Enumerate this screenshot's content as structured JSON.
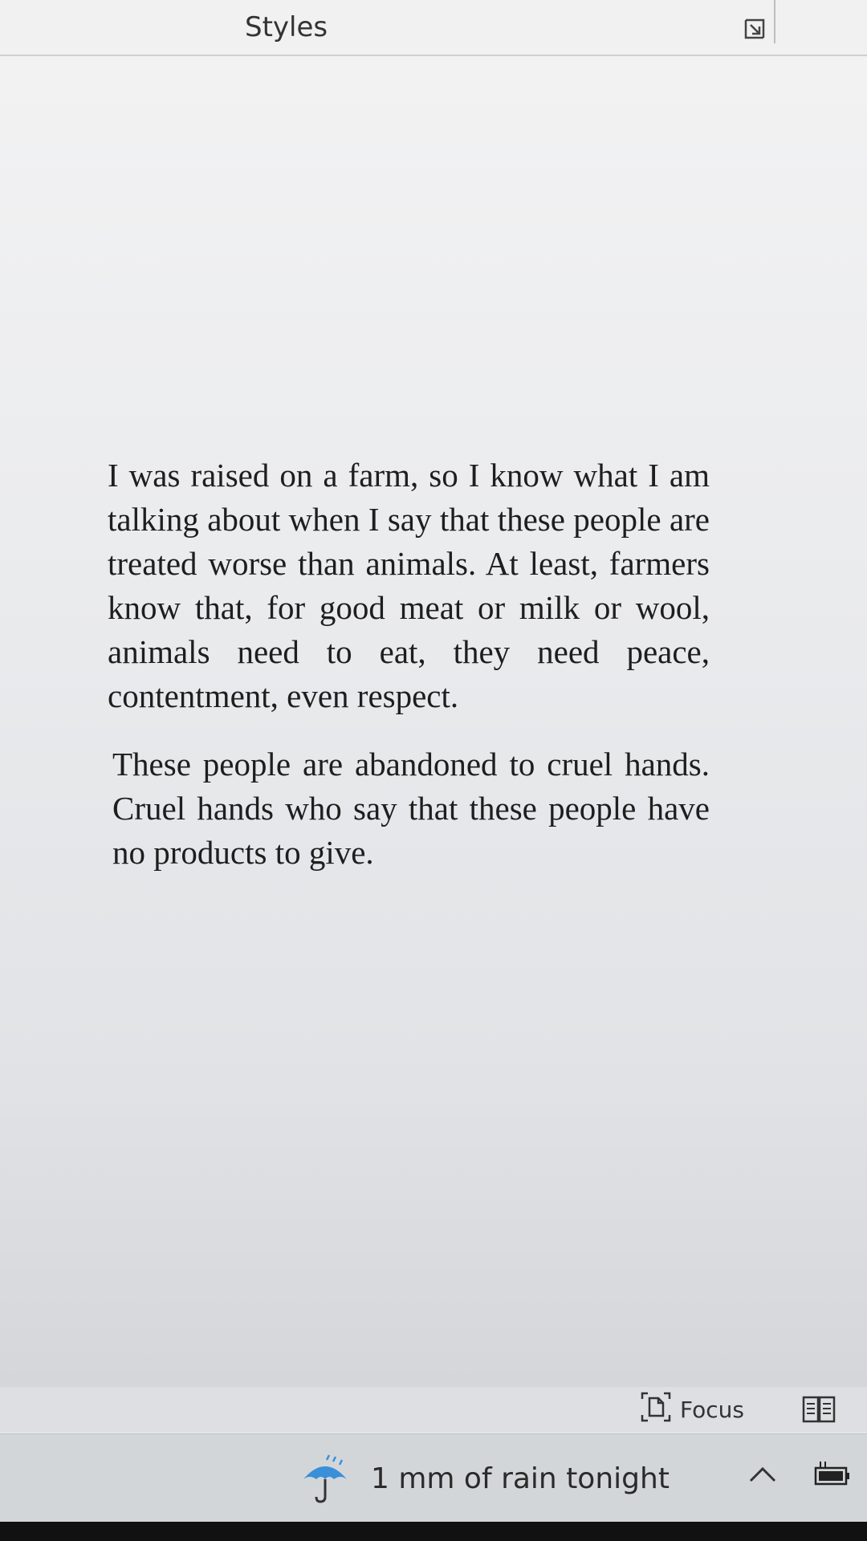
{
  "ribbon": {
    "styles_label": "Styles",
    "launcher_icon": "dialog-launcher-icon"
  },
  "document": {
    "paragraphs": [
      "I was raised on a farm, so I know what I am talking about when I say that these people are treated worse than animals. At least, farmers know that, for good meat or milk or wool, animals need to eat, they need peace, contentment, even respect.",
      "These people are abandoned to cruel hands. Cruel hands who say that these people have no products to give."
    ]
  },
  "statusbar": {
    "focus_label": "Focus",
    "focus_icon": "focus-icon",
    "read_mode_icon": "read-mode-icon"
  },
  "taskbar": {
    "weather_text": "1 mm of rain tonight",
    "weather_icon": "umbrella-icon",
    "weather_icon_color": "#3a8fd9",
    "tray_icon": "chevron-up-icon",
    "battery_icon": "battery-icon"
  }
}
